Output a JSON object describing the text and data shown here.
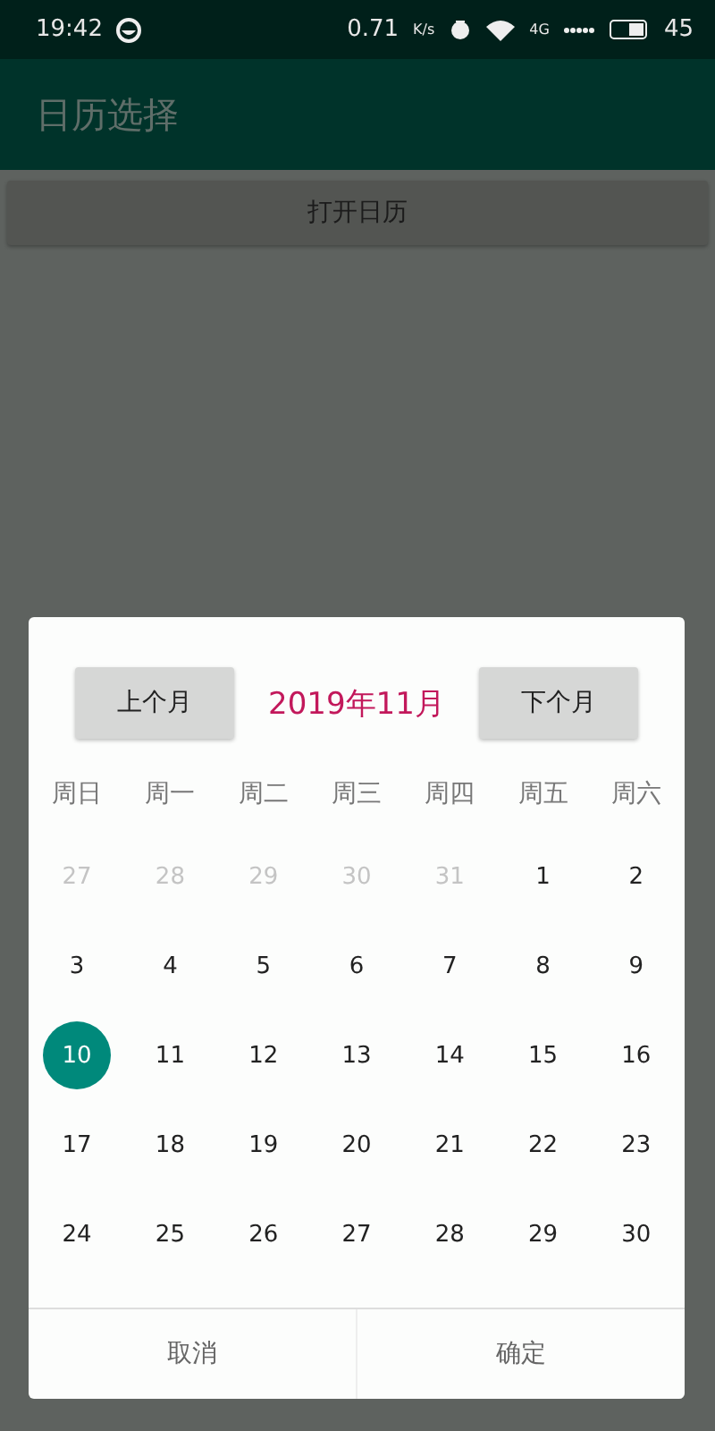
{
  "status_bar": {
    "time": "19:42",
    "speed": "0.71",
    "speed_unit": "K/s",
    "network": "4G",
    "battery": "45"
  },
  "app_bar": {
    "title": "日历选择"
  },
  "open_button": {
    "label": "打开日历"
  },
  "dialog": {
    "prev_button": "上个月",
    "month_title": "2019年11月",
    "next_button": "下个月",
    "weekdays": [
      "周日",
      "周一",
      "周二",
      "周三",
      "周四",
      "周五",
      "周六"
    ],
    "days": [
      {
        "label": "27",
        "in_month": false,
        "selected": false
      },
      {
        "label": "28",
        "in_month": false,
        "selected": false
      },
      {
        "label": "29",
        "in_month": false,
        "selected": false
      },
      {
        "label": "30",
        "in_month": false,
        "selected": false
      },
      {
        "label": "31",
        "in_month": false,
        "selected": false
      },
      {
        "label": "1",
        "in_month": true,
        "selected": false
      },
      {
        "label": "2",
        "in_month": true,
        "selected": false
      },
      {
        "label": "3",
        "in_month": true,
        "selected": false
      },
      {
        "label": "4",
        "in_month": true,
        "selected": false
      },
      {
        "label": "5",
        "in_month": true,
        "selected": false
      },
      {
        "label": "6",
        "in_month": true,
        "selected": false
      },
      {
        "label": "7",
        "in_month": true,
        "selected": false
      },
      {
        "label": "8",
        "in_month": true,
        "selected": false
      },
      {
        "label": "9",
        "in_month": true,
        "selected": false
      },
      {
        "label": "10",
        "in_month": true,
        "selected": true
      },
      {
        "label": "11",
        "in_month": true,
        "selected": false
      },
      {
        "label": "12",
        "in_month": true,
        "selected": false
      },
      {
        "label": "13",
        "in_month": true,
        "selected": false
      },
      {
        "label": "14",
        "in_month": true,
        "selected": false
      },
      {
        "label": "15",
        "in_month": true,
        "selected": false
      },
      {
        "label": "16",
        "in_month": true,
        "selected": false
      },
      {
        "label": "17",
        "in_month": true,
        "selected": false
      },
      {
        "label": "18",
        "in_month": true,
        "selected": false
      },
      {
        "label": "19",
        "in_month": true,
        "selected": false
      },
      {
        "label": "20",
        "in_month": true,
        "selected": false
      },
      {
        "label": "21",
        "in_month": true,
        "selected": false
      },
      {
        "label": "22",
        "in_month": true,
        "selected": false
      },
      {
        "label": "23",
        "in_month": true,
        "selected": false
      },
      {
        "label": "24",
        "in_month": true,
        "selected": false
      },
      {
        "label": "25",
        "in_month": true,
        "selected": false
      },
      {
        "label": "26",
        "in_month": true,
        "selected": false
      },
      {
        "label": "27",
        "in_month": true,
        "selected": false
      },
      {
        "label": "28",
        "in_month": true,
        "selected": false
      },
      {
        "label": "29",
        "in_month": true,
        "selected": false
      },
      {
        "label": "30",
        "in_month": true,
        "selected": false
      }
    ],
    "actions": [
      "取消",
      "确定"
    ]
  }
}
